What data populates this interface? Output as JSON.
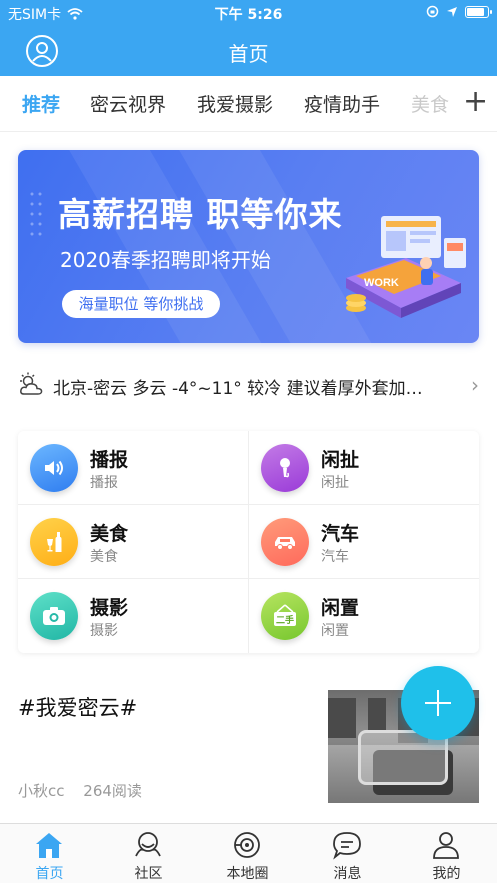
{
  "status": {
    "carrier": "无SIM卡",
    "time": "下午 5:26",
    "battery_level": 0.9
  },
  "nav": {
    "title": "首页",
    "avatar_icon": "user-circle-icon"
  },
  "tabs": [
    {
      "label": "推荐"
    },
    {
      "label": "密云视界"
    },
    {
      "label": "我爱摄影"
    },
    {
      "label": "疫情助手"
    },
    {
      "label": "美食"
    }
  ],
  "tabs_add_icon": "plus-icon",
  "banner": {
    "title": "高薪招聘 职等你来",
    "subtitle": "2020春季招聘即将开始",
    "pill": "海量职位 等你挑战",
    "card_text": "WORK"
  },
  "weather": {
    "text": "北京-密云 多云 -4°~11° 较冷 建议着厚外套加…",
    "icon": "cloudy-sun-icon"
  },
  "services": [
    {
      "title": "播报",
      "sub": "播报",
      "icon": "speaker-icon",
      "color_a": "#6cb7ff",
      "color_b": "#2f7df0"
    },
    {
      "title": "闲扯",
      "sub": "闲扯",
      "icon": "microphone-icon",
      "color_a": "#c37be6",
      "color_b": "#9a3bd8"
    },
    {
      "title": "美食",
      "sub": "美食",
      "icon": "bottle-glass-icon",
      "color_a": "#ffd24a",
      "color_b": "#ffae16"
    },
    {
      "title": "汽车",
      "sub": "汽车",
      "icon": "car-icon",
      "color_a": "#ff9b7a",
      "color_b": "#ff6a5c"
    },
    {
      "title": "摄影",
      "sub": "摄影",
      "icon": "camera-icon",
      "color_a": "#5ee0c8",
      "color_b": "#21b6a5"
    },
    {
      "title": "闲置",
      "sub": "闲置",
      "icon": "second-hand-tag-icon",
      "color_a": "#b6e460",
      "color_b": "#77c72e",
      "tag": "二手"
    }
  ],
  "post": {
    "title": "#我爱密云#",
    "author": "小秋cc",
    "reads": "264阅读"
  },
  "fab_icon": "plus-icon",
  "bottom_tabs": [
    {
      "label": "首页",
      "icon": "home-icon"
    },
    {
      "label": "社区",
      "icon": "community-icon"
    },
    {
      "label": "本地圈",
      "icon": "local-circle-icon"
    },
    {
      "label": "消息",
      "icon": "message-icon"
    },
    {
      "label": "我的",
      "icon": "profile-icon"
    }
  ],
  "colors": {
    "primary": "#3ba6f2",
    "fab": "#1fc0ea",
    "banner": "#4a75f1"
  }
}
